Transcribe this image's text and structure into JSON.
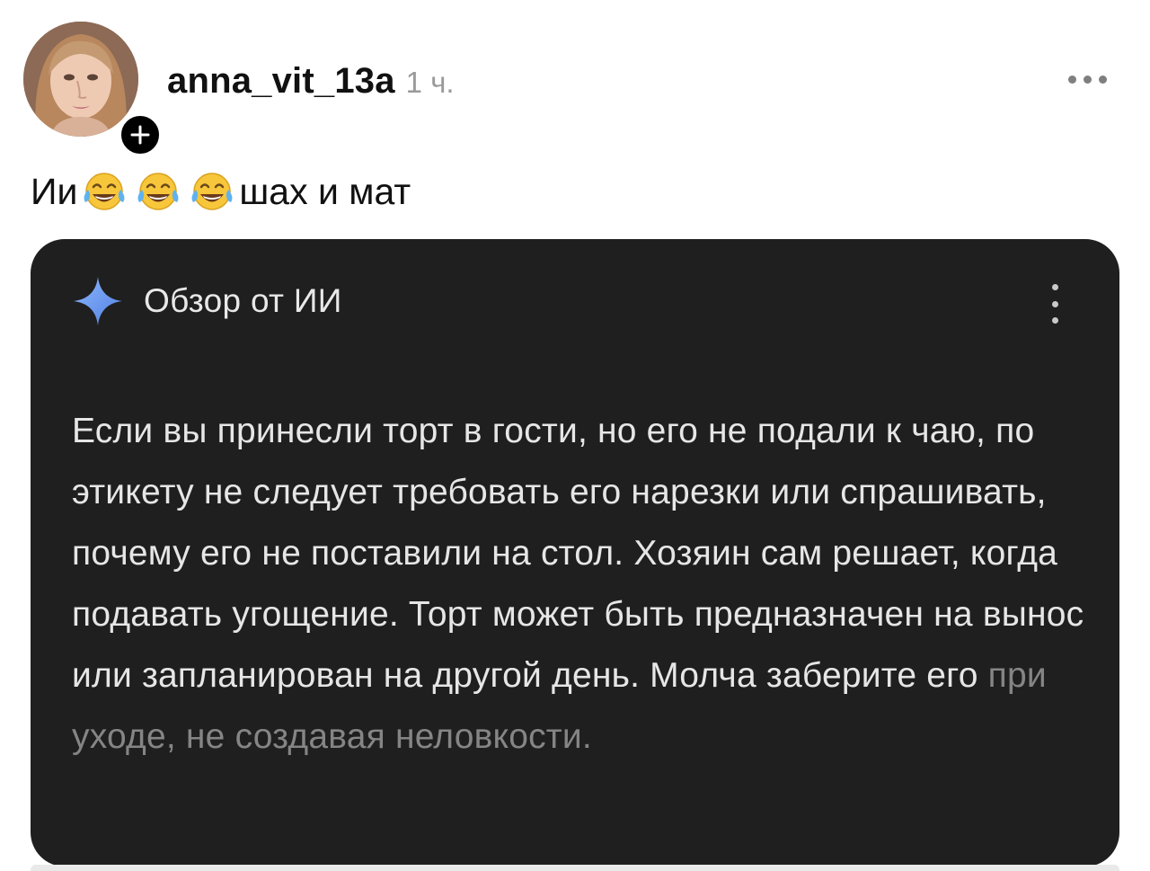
{
  "post": {
    "username": "anna_vit_13a",
    "time": "1 ч.",
    "caption": {
      "before": "Ии",
      "emojis": [
        "tears-of-joy-emoji",
        "tears-of-joy-emoji",
        "tears-of-joy-emoji"
      ],
      "after": "шах и мат"
    }
  },
  "ai_card": {
    "title": "Обзор от ИИ",
    "text_main": "Если вы принесли торт в гости, но его не подали к чаю, по этикету не следует требовать его нарезки или спрашивать, почему его не поставили на стол. Хозяин сам решает, когда подавать угощение. Торт может быть предназначен на вынос или запланирован на другой день. Молча заберите его ",
    "text_faded": "при уходе, не создавая неловкости.",
    "colors": {
      "background": "#1f1f1f",
      "text": "#e6e6e6",
      "faded_text": "#858585",
      "sparkle": "#6f9ef0"
    }
  },
  "icons": {
    "follow": "plus-icon",
    "more": "more-horizontal-icon",
    "card_menu": "more-vertical-icon",
    "card_badge": "sparkle-icon"
  }
}
